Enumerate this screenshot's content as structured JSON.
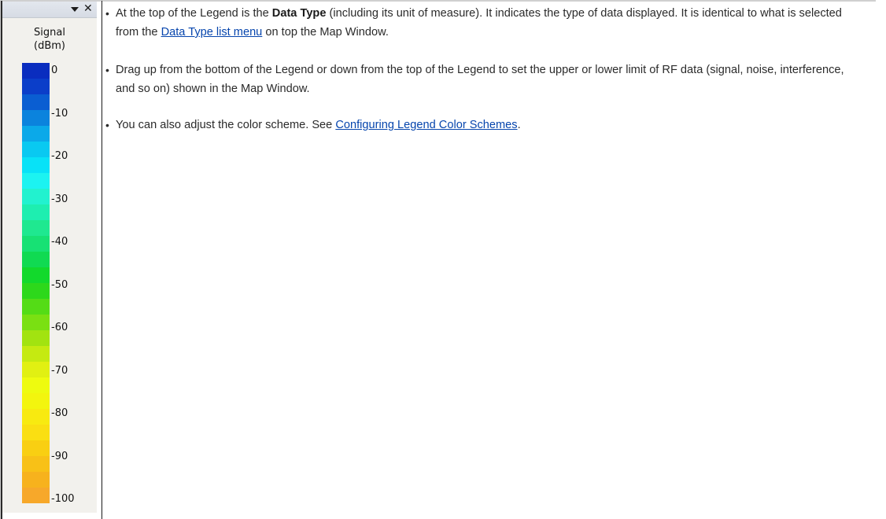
{
  "legend": {
    "title_line1": "Signal",
    "title_line2": "(dBm)",
    "ticks": [
      "0",
      "-10",
      "-20",
      "-30",
      "-40",
      "-50",
      "-60",
      "-70",
      "-80",
      "-90",
      "-100"
    ],
    "colors": [
      "#0a2dbf",
      "#0b3ec9",
      "#0a5ed2",
      "#0b83dd",
      "#0ba9e9",
      "#09c9f1",
      "#08e2f7",
      "#1cf3f1",
      "#22f2cf",
      "#1eeeb0",
      "#1fe890",
      "#17e174",
      "#10da52",
      "#12d92c",
      "#2dd81b",
      "#54dc16",
      "#7ae012",
      "#a2e310",
      "#c5ea11",
      "#e1f012",
      "#eefb0f",
      "#f3f50e",
      "#f8ea10",
      "#fadf12",
      "#f9cf12",
      "#f8c117",
      "#f7b21d",
      "#f7a82a"
    ]
  },
  "bullets": {
    "b1": {
      "pre": "At the top of the Legend is the ",
      "bold": "Data Type",
      "mid": " (including its unit of measure). It indicates the type of data displayed. It is identical to what is selected from the ",
      "link": "Data Type list menu",
      "post": " on top the Map Window."
    },
    "b2": {
      "text": "Drag up from the bottom of the Legend or down from the top of the Legend to set the upper or lower limit of RF data (signal, noise, interference, and so on) shown in the Map Window."
    },
    "b3": {
      "pre": "You can also adjust the color scheme. See ",
      "link": "Configuring Legend Color Schemes",
      "post": "."
    }
  }
}
